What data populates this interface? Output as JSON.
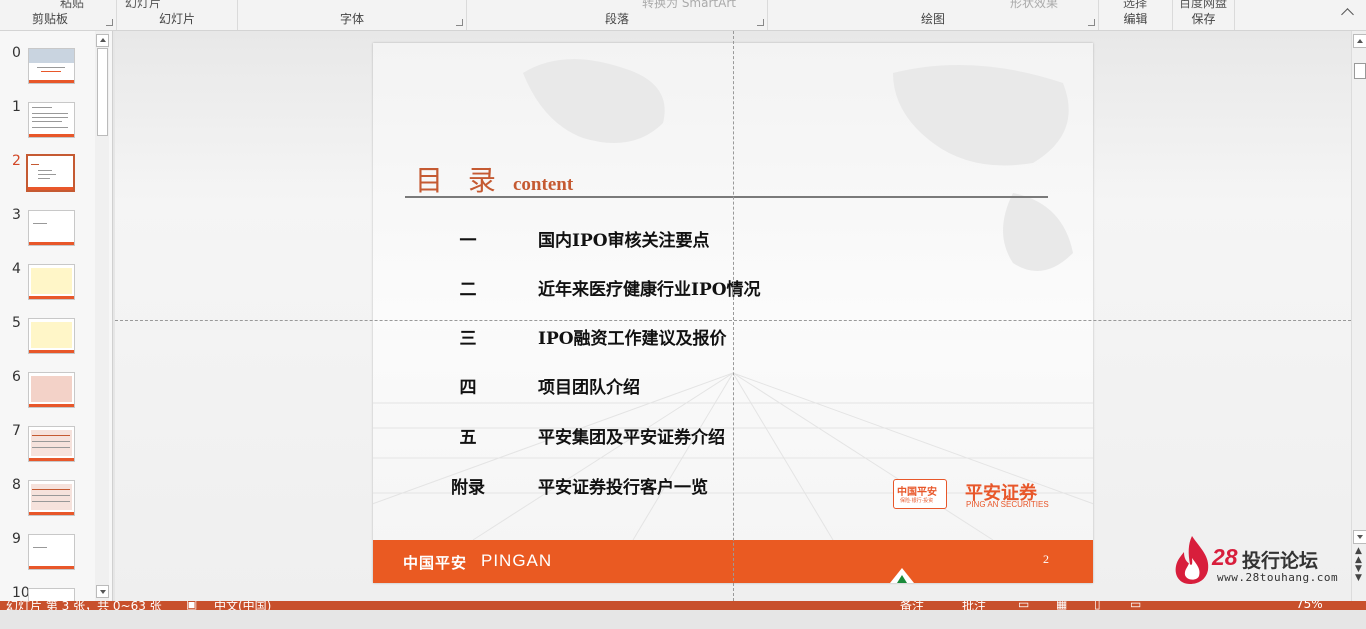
{
  "ribbon": {
    "groups": [
      {
        "label": "剪贴板",
        "top_item": "粘贴"
      },
      {
        "label": "幻灯片",
        "top_item": "幻灯片"
      },
      {
        "label": "字体",
        "top_item": ""
      },
      {
        "label": "段落",
        "top_item": "转换为 SmartArt"
      },
      {
        "label": "绘图",
        "top_item": "形状效果"
      },
      {
        "label": "编辑",
        "top_item": "选择"
      },
      {
        "label": "保存",
        "top_item": "百度网盘"
      }
    ]
  },
  "thumbnails": {
    "selected_index": 2,
    "items": [
      {
        "num": "0",
        "style": "cover"
      },
      {
        "num": "1",
        "style": "text"
      },
      {
        "num": "2",
        "style": "toc"
      },
      {
        "num": "3",
        "style": "blank"
      },
      {
        "num": "4",
        "style": "yellow"
      },
      {
        "num": "5",
        "style": "yellow"
      },
      {
        "num": "6",
        "style": "red"
      },
      {
        "num": "7",
        "style": "table"
      },
      {
        "num": "8",
        "style": "table"
      },
      {
        "num": "9",
        "style": "blank"
      },
      {
        "num": "10",
        "style": "blank"
      }
    ]
  },
  "slide": {
    "title_zh": "目 录",
    "title_en": "content",
    "items": [
      {
        "key": "一",
        "text": "国内IPO审核关注要点"
      },
      {
        "key": "二",
        "text": "近年来医疗健康行业IPO情况"
      },
      {
        "key": "三",
        "text": "IPO融资工作建议及报价"
      },
      {
        "key": "四",
        "text": "项目团队介绍"
      },
      {
        "key": "五",
        "text": "平安集团及平安证券介绍"
      },
      {
        "key": "附录",
        "text": "平安证券投行客户一览"
      }
    ],
    "footer_brand_zh": "中国平安",
    "footer_brand_en": "PINGAN",
    "page_number": "2",
    "logo_box_text": "中国平安",
    "logo_box_sub": "保险·银行·投资",
    "logo_zh": "平安证券",
    "logo_en": "PING AN SECURITIES"
  },
  "watermark": {
    "num": "28",
    "zh": "投行论坛",
    "url": "www.28touhang.com"
  },
  "status": {
    "slide_info": "幻灯片 第 3 张，共 0~63 张",
    "language": "中文(中国)",
    "notes": "备注",
    "comments": "批注",
    "zoom": "75%"
  },
  "colors": {
    "accent": "#ea5a22",
    "title": "#c55a32",
    "status_bar": "#c8502c"
  }
}
